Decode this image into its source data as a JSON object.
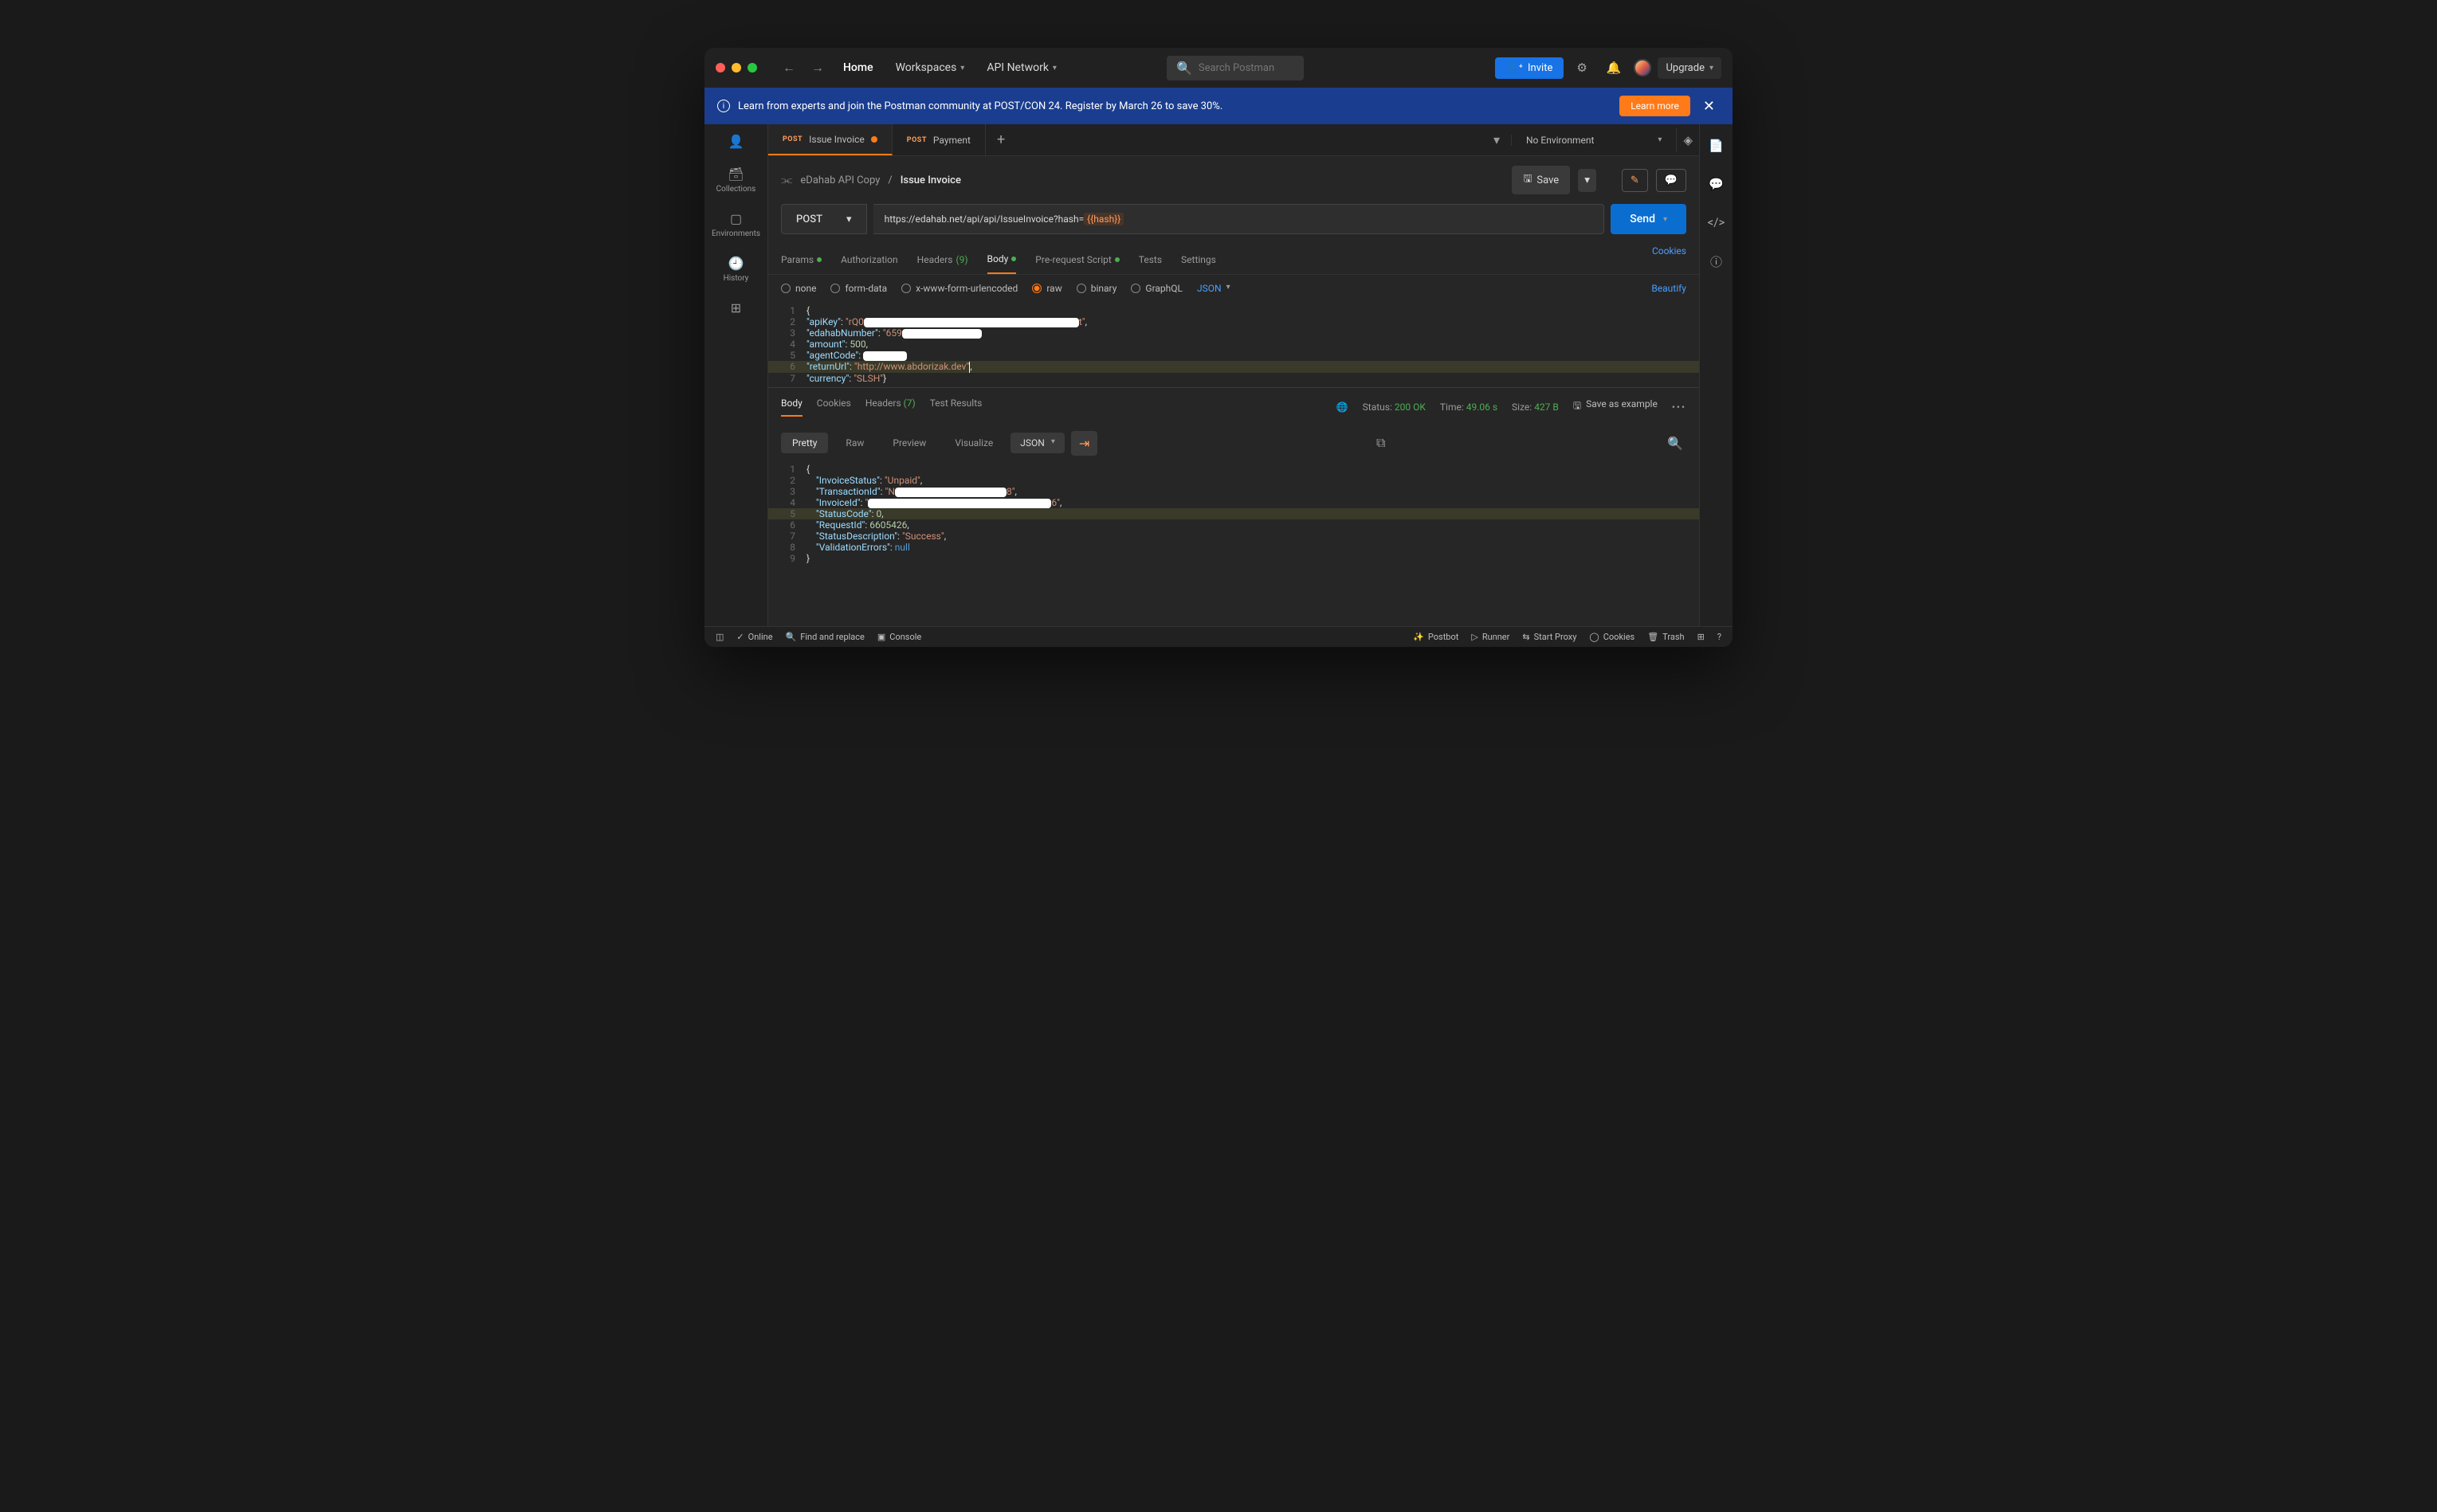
{
  "titlebar": {
    "home": "Home",
    "workspaces": "Workspaces",
    "api_network": "API Network",
    "search_placeholder": "Search Postman",
    "invite": "Invite",
    "upgrade": "Upgrade"
  },
  "banner": {
    "text": "Learn from experts and join the Postman community at POST/CON 24. Register by March 26 to save 30%.",
    "learn_more": "Learn more"
  },
  "leftnav": {
    "collections": "Collections",
    "environments": "Environments",
    "history": "History"
  },
  "tabs": [
    {
      "method": "POST",
      "label": "Issue Invoice",
      "unsaved": true,
      "active": true
    },
    {
      "method": "POST",
      "label": "Payment",
      "unsaved": false,
      "active": false
    }
  ],
  "environment": "No Environment",
  "breadcrumb": {
    "parent": "eDahab API Copy",
    "current": "Issue Invoice",
    "save": "Save"
  },
  "request": {
    "method": "POST",
    "url_prefix": "https://edahab.net/api/api/IssueInvoice?hash=",
    "url_var": "{{hash}}",
    "send": "Send"
  },
  "reqtabs": {
    "params": "Params",
    "auth": "Authorization",
    "headers": "Headers",
    "headers_count": "(9)",
    "body": "Body",
    "prereq": "Pre-request Script",
    "tests": "Tests",
    "settings": "Settings",
    "cookies": "Cookies"
  },
  "bodytype": {
    "none": "none",
    "formdata": "form-data",
    "urlenc": "x-www-form-urlencoded",
    "raw": "raw",
    "binary": "binary",
    "graphql": "GraphQL",
    "json": "JSON",
    "beautify": "Beautify"
  },
  "req_body": {
    "lines": [
      "1",
      "2",
      "3",
      "4",
      "5",
      "6",
      "7"
    ],
    "apiKey_k": "\"apiKey\"",
    "apiKey_v1": "\"rQ0",
    "apiKey_v2": "t\"",
    "edahab_k": "\"edahabNumber\"",
    "edahab_v1": "\"659",
    "amount_k": "\"amount\"",
    "amount_v": "500",
    "agent_k": "\"agentCode\"",
    "return_k": "\"returnUrl\"",
    "return_v": "\"http://www.abdorizak.dev\"",
    "currency_k": "\"currency\"",
    "currency_v": "\"SLSH\""
  },
  "resp_tabs": {
    "body": "Body",
    "cookies": "Cookies",
    "headers": "Headers",
    "headers_count": "(7)",
    "tests": "Test Results"
  },
  "resp_meta": {
    "status_l": "Status:",
    "status_v": "200 OK",
    "time_l": "Time:",
    "time_v": "49.06 s",
    "size_l": "Size:",
    "size_v": "427 B",
    "save": "Save as example"
  },
  "view": {
    "pretty": "Pretty",
    "raw": "Raw",
    "preview": "Preview",
    "visualize": "Visualize",
    "json": "JSON"
  },
  "resp_body": {
    "lines": [
      "1",
      "2",
      "3",
      "4",
      "5",
      "6",
      "7",
      "8",
      "9"
    ],
    "invstat_k": "\"InvoiceStatus\"",
    "invstat_v": "\"Unpaid\"",
    "txid_k": "\"TransactionId\"",
    "txid_v1": "\"N",
    "txid_v2": "8\"",
    "invid_k": "\"InvoiceId\"",
    "invid_v1": "\"",
    "invid_v2": "6\"",
    "statcode_k": "\"StatusCode\"",
    "statcode_v": "0",
    "reqid_k": "\"RequestId\"",
    "reqid_v": "6605426",
    "statdesc_k": "\"StatusDescription\"",
    "statdesc_v": "\"Success\"",
    "valerr_k": "\"ValidationErrors\"",
    "valerr_v": "null"
  },
  "statusbar": {
    "online": "Online",
    "find": "Find and replace",
    "console": "Console",
    "postbot": "Postbot",
    "runner": "Runner",
    "proxy": "Start Proxy",
    "cookies": "Cookies",
    "trash": "Trash"
  }
}
